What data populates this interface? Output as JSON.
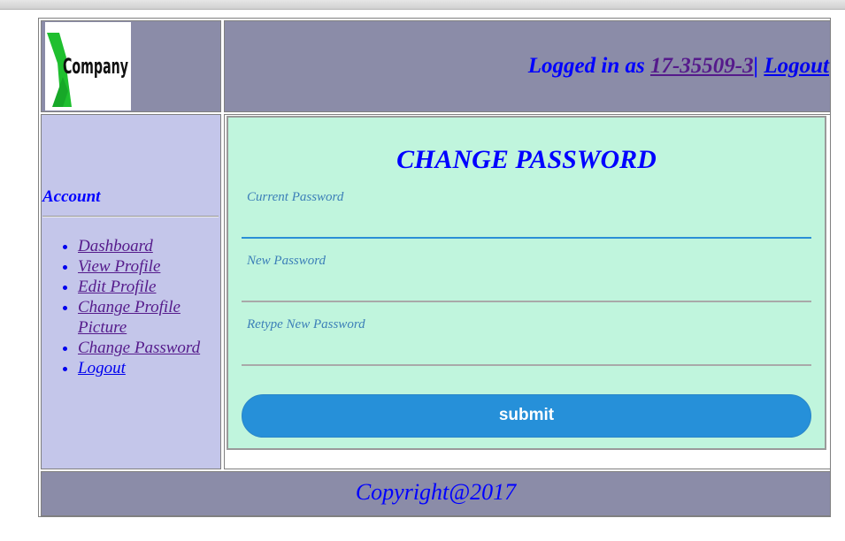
{
  "header": {
    "logo_text": "Company",
    "logged_in_prefix": "Logged in as ",
    "user_id": "17-35509-3",
    "separator": "| ",
    "logout_label": "Logout"
  },
  "sidebar": {
    "title": "Account",
    "items": [
      {
        "label": "Dashboard"
      },
      {
        "label": "View Profile"
      },
      {
        "label": "Edit Profile"
      },
      {
        "label": "Change Profile Picture"
      },
      {
        "label": "Change Password"
      },
      {
        "label": "Logout"
      }
    ]
  },
  "form": {
    "title": "CHANGE PASSWORD",
    "current_label": "Current Password",
    "current_value": "",
    "new_label": "New Password",
    "new_value": "",
    "retype_label": "Retype New Password",
    "retype_value": "",
    "submit_label": "submit"
  },
  "footer": {
    "copyright": "Copyright@2017"
  },
  "colors": {
    "header_bg": "#8b8ca8",
    "sidebar_bg": "#c4c6ea",
    "form_bg": "#c0f5dd",
    "accent_blue": "#0000ff",
    "button_blue": "#2690d9",
    "logo_green": "#1fbf2f"
  }
}
